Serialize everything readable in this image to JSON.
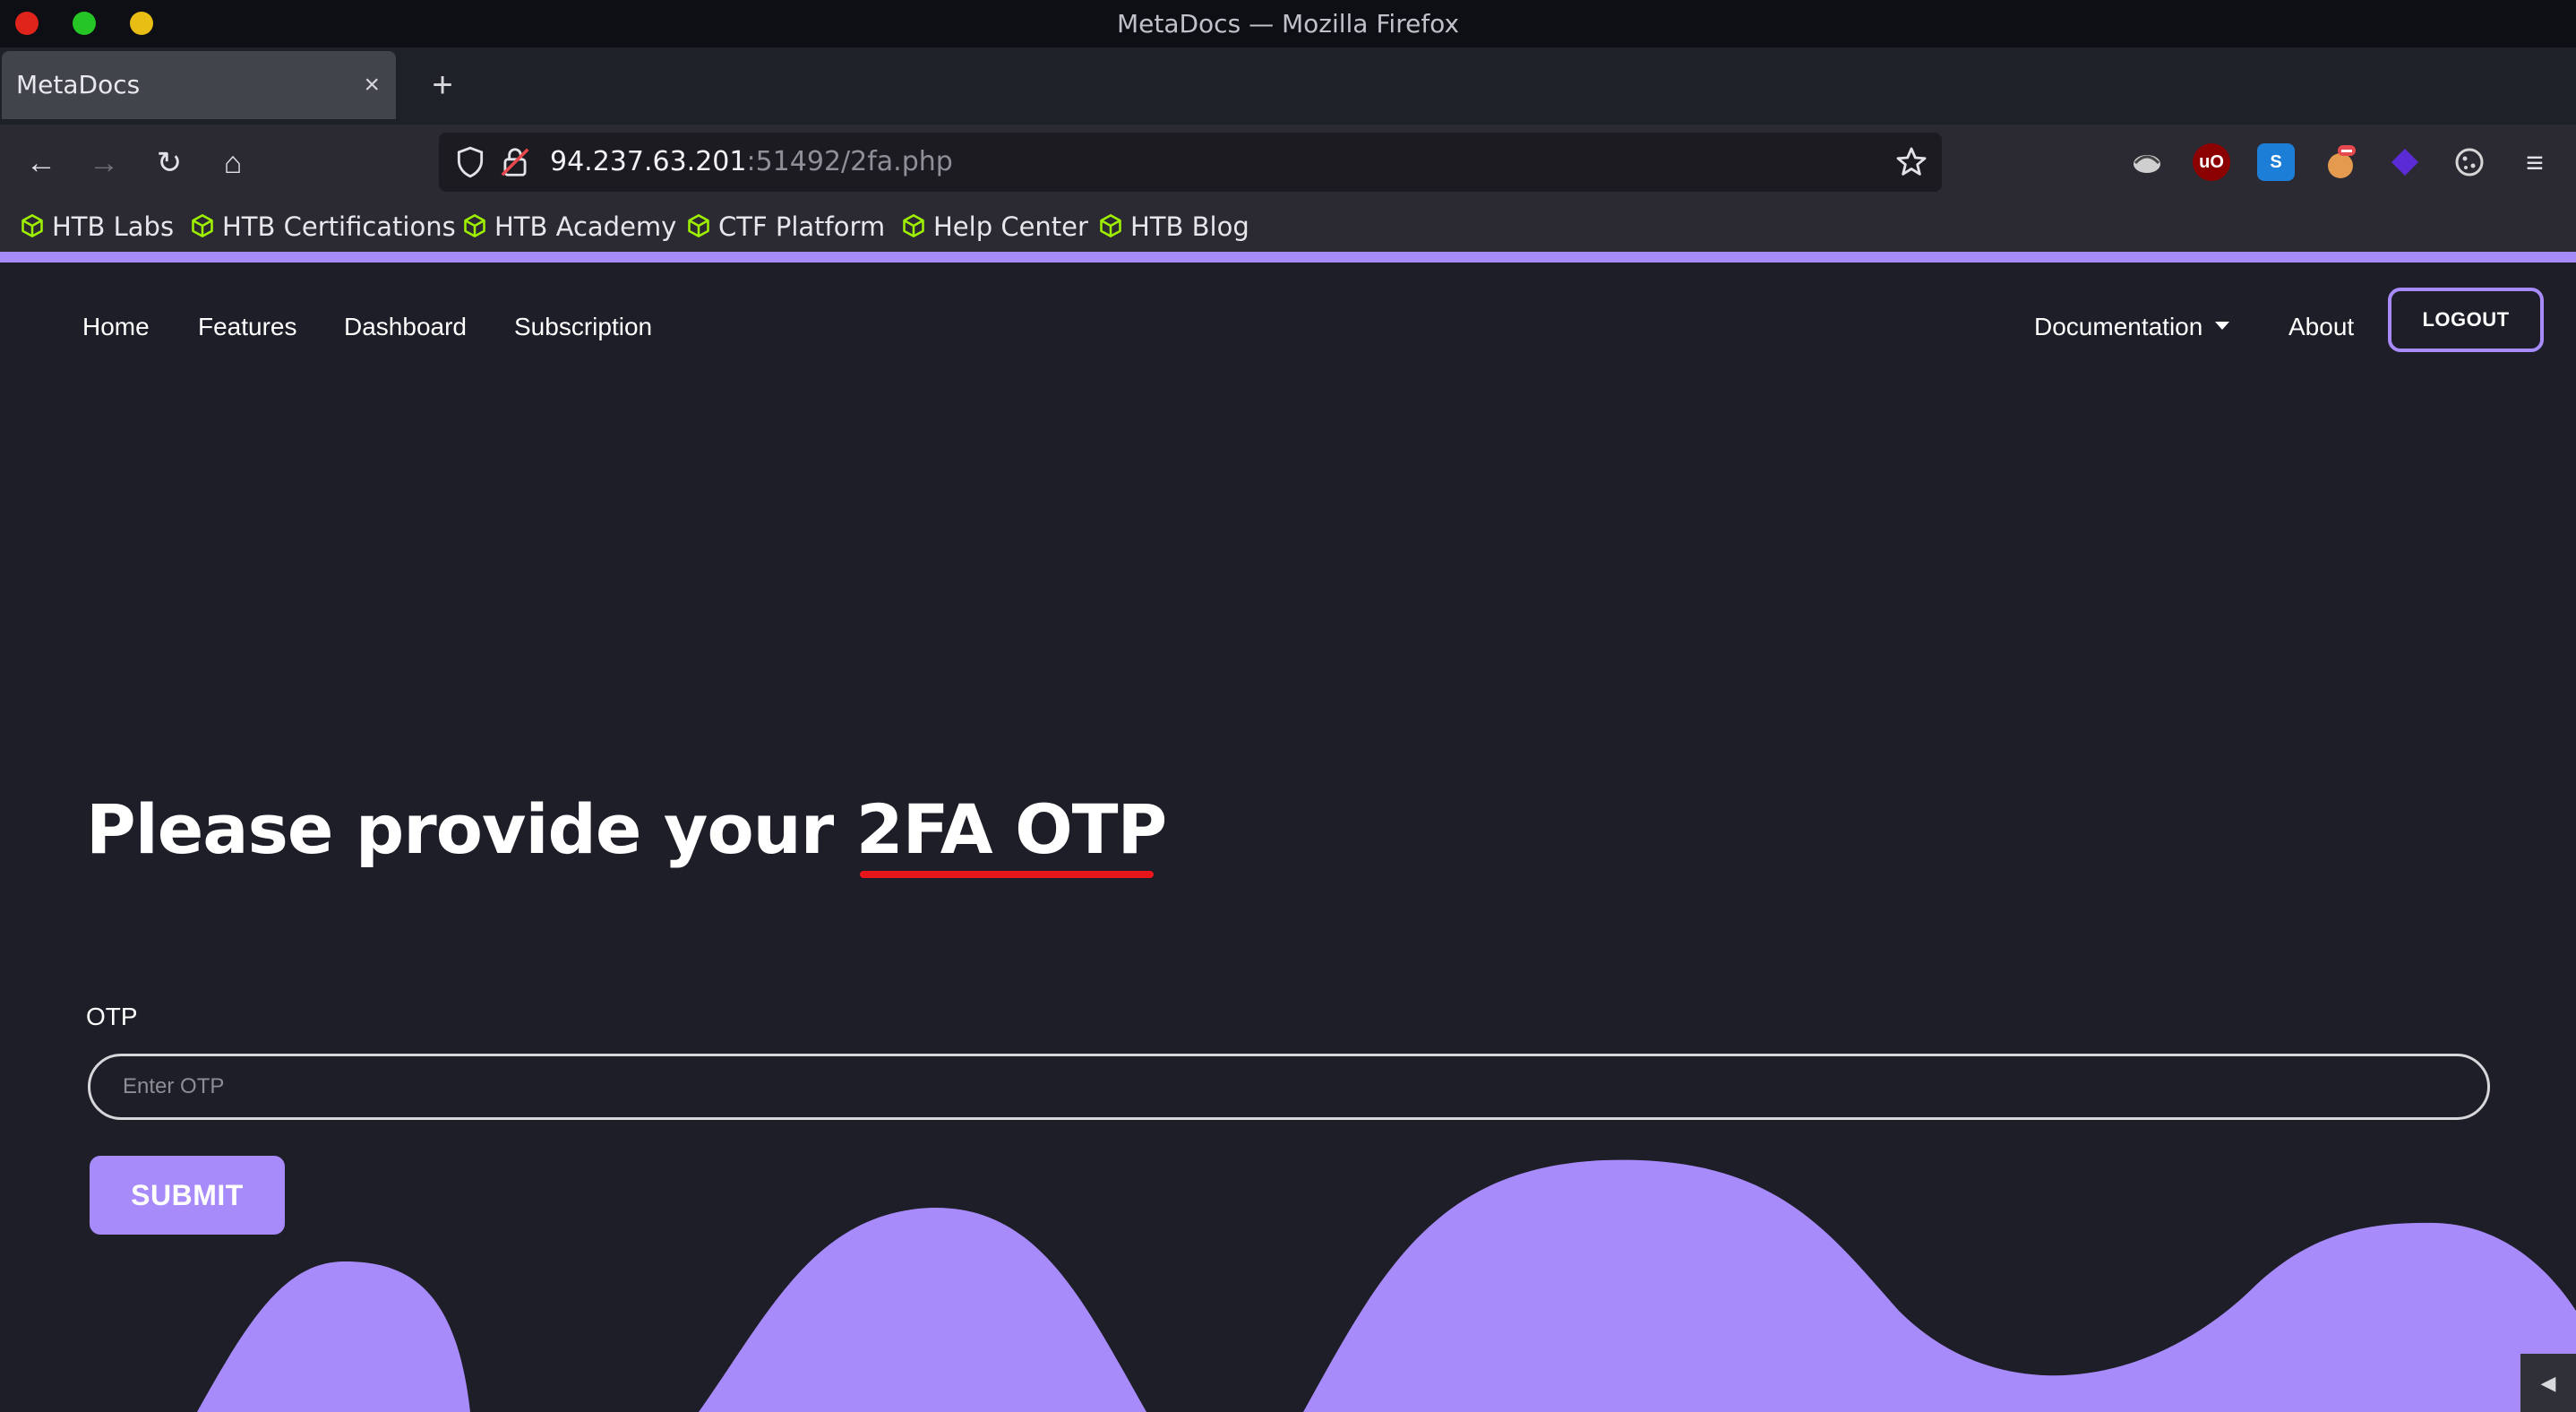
{
  "window": {
    "title": "MetaDocs — Mozilla Firefox"
  },
  "tabs": [
    {
      "label": "MetaDocs",
      "close": "×"
    }
  ],
  "new_tab": "+",
  "nav": {
    "back": "←",
    "forward": "→",
    "reload": "↻",
    "home": "⌂"
  },
  "urlbar": {
    "host": "94.237.63.201",
    "rest": ":51492/2fa.php"
  },
  "extensions": [
    {
      "name": "extension-icon-1",
      "color": "#d9d9d9"
    },
    {
      "name": "ublock-icon",
      "label": "uO",
      "color": "#8b0000"
    },
    {
      "name": "s-extension-icon",
      "label": "S",
      "color": "#1c7ed6"
    },
    {
      "name": "extension-icon-4",
      "color": "#e49b4f"
    },
    {
      "name": "extension-icon-5",
      "color": "#5b2bd6"
    },
    {
      "name": "cookie-icon",
      "color": "#d6d6d6"
    }
  ],
  "bookmarks": [
    {
      "label": "HTB Labs"
    },
    {
      "label": "HTB Certifications"
    },
    {
      "label": "HTB Academy"
    },
    {
      "label": "CTF Platform"
    },
    {
      "label": "Help Center"
    },
    {
      "label": "HTB Blog"
    }
  ],
  "site_nav": {
    "home": "Home",
    "features": "Features",
    "dashboard": "Dashboard",
    "subscription": "Subscription",
    "documentation": "Documentation",
    "about": "About",
    "logout": "LOGOUT"
  },
  "main": {
    "heading_prefix": "Please provide your ",
    "heading_highlight": "2FA OTP",
    "otp_label": "OTP",
    "otp_placeholder": "Enter OTP",
    "otp_value": "",
    "submit": "SUBMIT"
  },
  "colors": {
    "accent": "#a78bfa",
    "background": "#1d1e27",
    "underline": "#e7161b"
  }
}
